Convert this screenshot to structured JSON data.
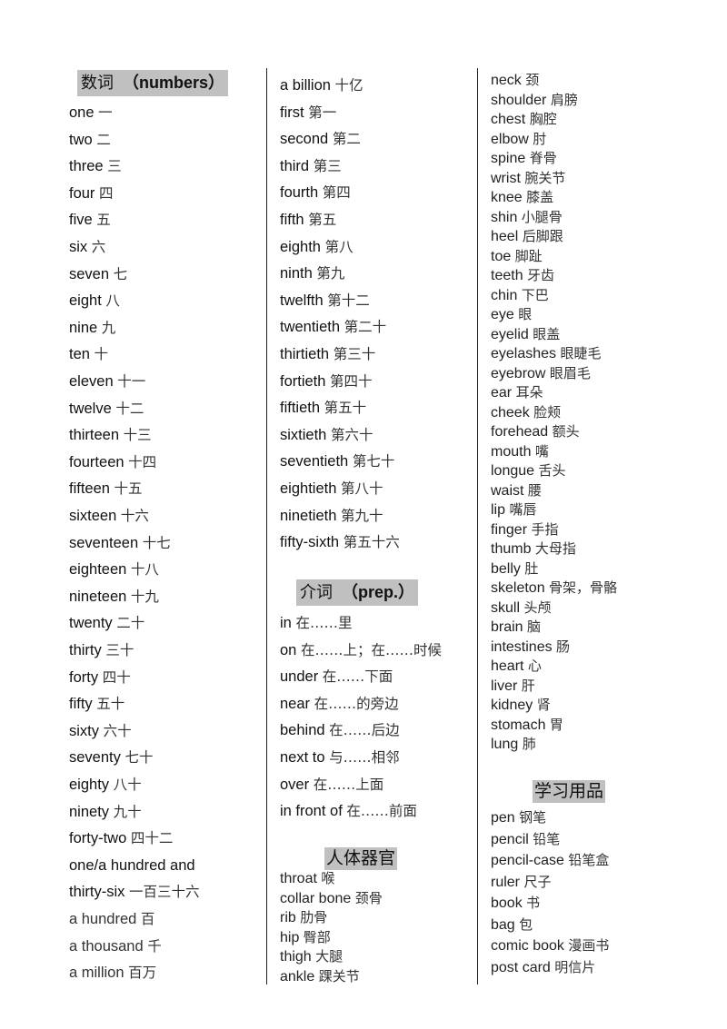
{
  "column1": {
    "header": {
      "zh": "数词",
      "en": "（numbers）"
    },
    "items": [
      {
        "en": "one",
        "zh": "一"
      },
      {
        "en": "two",
        "zh": "二"
      },
      {
        "en": "three",
        "zh": "三"
      },
      {
        "en": "four",
        "zh": "四"
      },
      {
        "en": "five",
        "zh": "五"
      },
      {
        "en": "six",
        "zh": "六"
      },
      {
        "en": "seven",
        "zh": "七"
      },
      {
        "en": "eight",
        "zh": "八"
      },
      {
        "en": "nine",
        "zh": "九"
      },
      {
        "en": "ten",
        "zh": "十"
      },
      {
        "en": "eleven",
        "zh": "十一"
      },
      {
        "en": "twelve",
        "zh": "十二"
      },
      {
        "en": "thirteen",
        "zh": "十三"
      },
      {
        "en": "fourteen",
        "zh": "十四"
      },
      {
        "en": "fifteen",
        "zh": "十五"
      },
      {
        "en": "sixteen",
        "zh": "十六"
      },
      {
        "en": "seventeen",
        "zh": "十七"
      },
      {
        "en": "eighteen",
        "zh": "十八"
      },
      {
        "en": "nineteen",
        "zh": "十九"
      },
      {
        "en": "twenty",
        "zh": "二十"
      },
      {
        "en": "thirty",
        "zh": "三十"
      },
      {
        "en": "forty",
        "zh": "四十"
      },
      {
        "en": "fifty",
        "zh": "五十"
      },
      {
        "en": "sixty",
        "zh": "六十"
      },
      {
        "en": "seventy",
        "zh": "七十"
      },
      {
        "en": "eighty",
        "zh": "八十"
      },
      {
        "en": "ninety",
        "zh": "九十"
      },
      {
        "en": "forty-two",
        "zh": "四十二"
      },
      {
        "en": "one/a hundred and",
        "zh": ""
      },
      {
        "en": "thirty-six",
        "zh": "一百三十六"
      },
      {
        "en": "a hundred ",
        "zh": "百"
      },
      {
        "en": "a thousand ",
        "zh": "千"
      },
      {
        "en": "a million ",
        "zh": "百万"
      }
    ]
  },
  "column2": {
    "numbers_cont": [
      {
        "en": "a billion ",
        "zh": "十亿"
      },
      {
        "en": "first",
        "zh": "第一"
      },
      {
        "en": "second",
        "zh": "第二"
      },
      {
        "en": "third",
        "zh": "第三"
      },
      {
        "en": "fourth",
        "zh": "第四"
      },
      {
        "en": "fifth",
        "zh": "第五"
      },
      {
        "en": "eighth",
        "zh": "第八"
      },
      {
        "en": "ninth",
        "zh": "第九"
      },
      {
        "en": "twelfth",
        "zh": "第十二"
      },
      {
        "en": "twentieth",
        "zh": "第二十"
      },
      {
        "en": "thirtieth",
        "zh": "第三十"
      },
      {
        "en": "fortieth",
        "zh": "第四十"
      },
      {
        "en": "fiftieth",
        "zh": "第五十"
      },
      {
        "en": "sixtieth",
        "zh": "第六十"
      },
      {
        "en": "seventieth",
        "zh": "第七十"
      },
      {
        "en": "eightieth",
        "zh": "第八十"
      },
      {
        "en": "ninetieth",
        "zh": "第九十"
      },
      {
        "en": "fifty-sixth",
        "zh": "第五十六"
      }
    ],
    "prep_header": {
      "zh": "介词",
      "en": "（prep.）"
    },
    "prep_items": [
      {
        "en": "in",
        "zh": "在……里"
      },
      {
        "en": "on",
        "zh": "在……上；在……时候"
      },
      {
        "en": "under",
        "zh": "在……下面"
      },
      {
        "en": "near",
        "zh": "在……的旁边"
      },
      {
        "en": "behind",
        "zh": "在……后边"
      },
      {
        "en": "next to",
        "zh": "与……相邻"
      },
      {
        "en": "over",
        "zh": "在……上面"
      },
      {
        "en": "in front of",
        "zh": "在……前面"
      }
    ],
    "body_header": {
      "zh": "人体器官"
    },
    "body_items": [
      {
        "en": "throat ",
        "zh": "喉"
      },
      {
        "en": "collar bone ",
        "zh": "颈骨"
      },
      {
        "en": "rib ",
        "zh": "肋骨"
      },
      {
        "en": "hip ",
        "zh": "臀部"
      },
      {
        "en": "thigh ",
        "zh": "大腿"
      },
      {
        "en": "ankle ",
        "zh": "踝关节"
      }
    ]
  },
  "column3": {
    "body_items": [
      {
        "en": "neck ",
        "zh": "颈"
      },
      {
        "en": "shoulder ",
        "zh": "肩膀"
      },
      {
        "en": "chest ",
        "zh": "胸腔"
      },
      {
        "en": "elbow ",
        "zh": "肘"
      },
      {
        "en": "spine ",
        "zh": "脊骨"
      },
      {
        "en": "wrist ",
        "zh": "腕关节"
      },
      {
        "en": "knee ",
        "zh": "膝盖"
      },
      {
        "en": "shin ",
        "zh": "小腿骨"
      },
      {
        "en": "heel ",
        "zh": "后脚跟"
      },
      {
        "en": "toe ",
        "zh": "脚趾"
      },
      {
        "en": "teeth ",
        "zh": "牙齿"
      },
      {
        "en": "chin ",
        "zh": "下巴"
      },
      {
        "en": "eye ",
        "zh": "眼"
      },
      {
        "en": "eyelid  ",
        "zh": "眼盖"
      },
      {
        "en": "eyelashes ",
        "zh": "眼睫毛"
      },
      {
        "en": "eyebrow ",
        "zh": "眼眉毛"
      },
      {
        "en": "ear ",
        "zh": "耳朵"
      },
      {
        "en": "cheek ",
        "zh": "脸颊"
      },
      {
        "en": "forehead ",
        "zh": "额头"
      },
      {
        "en": "mouth ",
        "zh": "嘴"
      },
      {
        "en": "longue ",
        "zh": "舌头"
      },
      {
        "en": "waist ",
        "zh": "腰"
      },
      {
        "en": "lip ",
        "zh": "嘴唇"
      },
      {
        "en": "finger ",
        "zh": "手指"
      },
      {
        "en": "thumb ",
        "zh": "大母指"
      },
      {
        "en": "belly ",
        "zh": "肚"
      },
      {
        "en": "skeleton ",
        "zh": "骨架，骨骼"
      },
      {
        "en": "skull ",
        "zh": "头颅"
      },
      {
        "en": "brain ",
        "zh": "脑"
      },
      {
        "en": "intestines ",
        "zh": "肠"
      },
      {
        "en": "heart ",
        "zh": "心"
      },
      {
        "en": "liver ",
        "zh": "肝"
      },
      {
        "en": "kidney ",
        "zh": "肾"
      },
      {
        "en": "stomach ",
        "zh": "胃"
      },
      {
        "en": "lung ",
        "zh": "肺"
      }
    ],
    "supplies_header": {
      "zh": "学习用品"
    },
    "supplies_items": [
      {
        "en": "pen",
        "zh": "钢笔"
      },
      {
        "en": "pencil",
        "zh": "铅笔"
      },
      {
        "en": "pencil-case",
        "zh": "铅笔盒"
      },
      {
        "en": "ruler",
        "zh": "尺子"
      },
      {
        "en": "book",
        "zh": "书"
      },
      {
        "en": "bag",
        "zh": "包"
      },
      {
        "en": "comic book",
        "zh": "漫画书"
      },
      {
        "en": "post card",
        "zh": "明信片"
      }
    ]
  }
}
